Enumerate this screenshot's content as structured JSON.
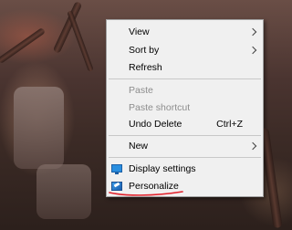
{
  "menu": {
    "items": [
      {
        "label": "View",
        "submenu": true
      },
      {
        "label": "Sort by",
        "submenu": true
      },
      {
        "label": "Refresh"
      },
      {
        "label": "Paste",
        "disabled": true
      },
      {
        "label": "Paste shortcut",
        "disabled": true
      },
      {
        "label": "Undo Delete",
        "shortcut": "Ctrl+Z"
      },
      {
        "label": "New",
        "submenu": true
      },
      {
        "label": "Display settings",
        "icon": "display-settings-icon"
      },
      {
        "label": "Personalize",
        "icon": "personalize-icon"
      }
    ]
  },
  "annotation": {
    "underline_color": "#e0202a"
  }
}
